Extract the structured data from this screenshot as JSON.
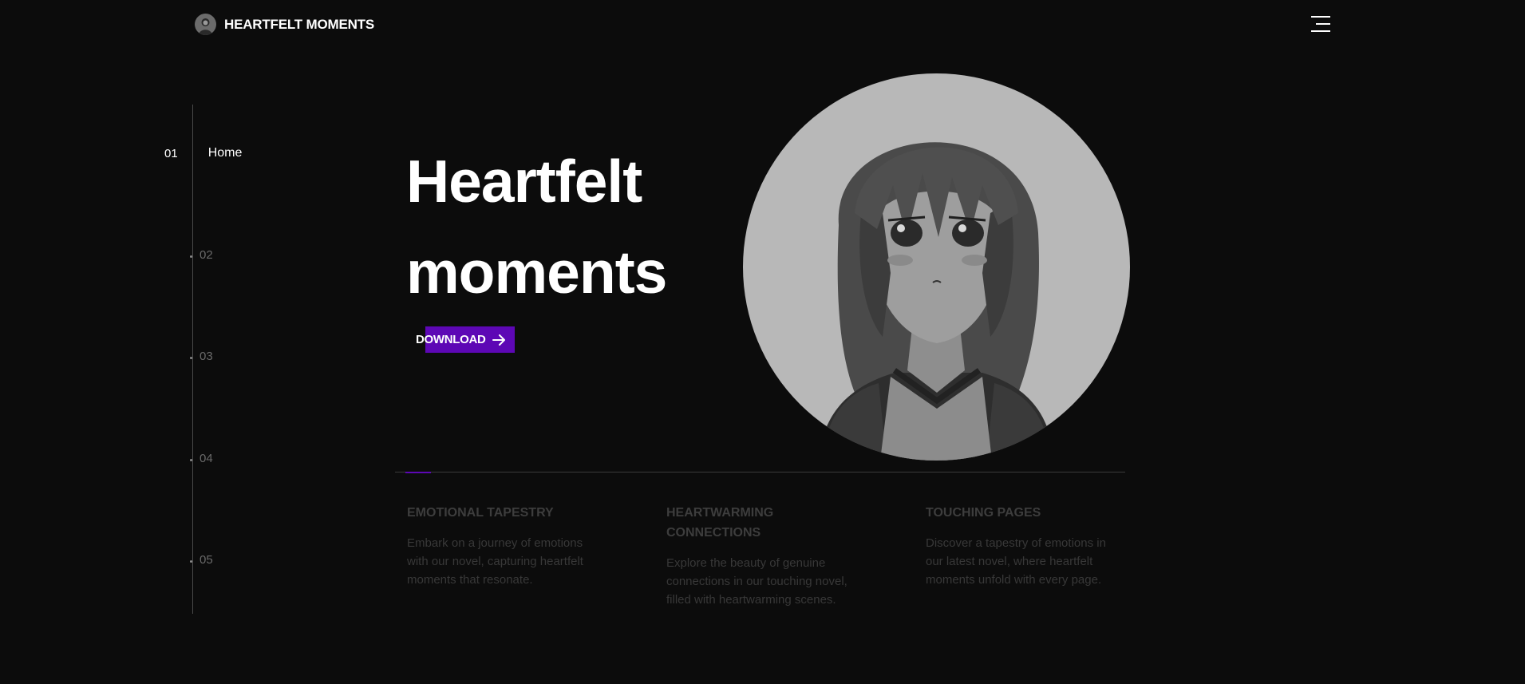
{
  "header": {
    "brand": "HEARTFELT MOMENTS",
    "logo_icon": "avatar-logo-icon",
    "menu_icon": "hamburger-menu-icon"
  },
  "nav": {
    "items": [
      {
        "num": "01",
        "label": "Home",
        "active": true
      },
      {
        "num": "02"
      },
      {
        "num": "03"
      },
      {
        "num": "04"
      },
      {
        "num": "05"
      }
    ]
  },
  "hero": {
    "title_line1": "Heartfelt",
    "title_line2": "moments",
    "download_label": "DOWNLOAD",
    "download_icon": "arrow-right-icon",
    "portrait_icon": "anime-girl-portrait"
  },
  "features": [
    {
      "title": "EMOTIONAL TAPESTRY",
      "text": "Embark on a journey of emotions with our novel, capturing heartfelt moments that resonate."
    },
    {
      "title": "HEARTWARMING CONNECTIONS",
      "text": "Explore the beauty of genuine connections in our touching novel, filled with heartwarming scenes."
    },
    {
      "title": "TOUCHING PAGES",
      "text": "Discover a tapestry of emotions in our latest novel, where heartfelt moments unfold with every page."
    }
  ],
  "colors": {
    "background": "#0c0c0c",
    "accent": "#5d07b5",
    "text": "#ffffff",
    "muted": "#3d3d3d"
  }
}
